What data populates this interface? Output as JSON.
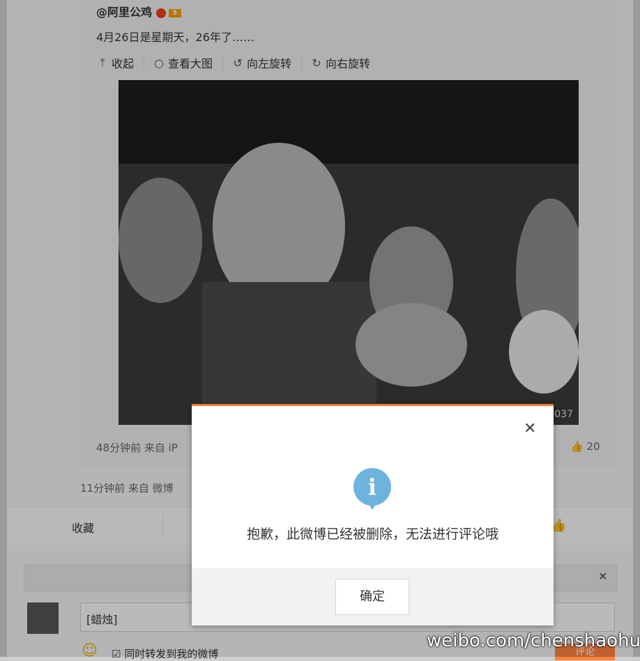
{
  "post": {
    "author": "@阿里公鸡",
    "badge_text": "5",
    "text": "4月26日是星期天，26年了……",
    "tools": [
      {
        "icon": "collapse-icon",
        "glyph": "⤒",
        "label": "收起"
      },
      {
        "icon": "search-icon",
        "glyph": "○",
        "label": "查看大图"
      },
      {
        "icon": "rotate-left-icon",
        "glyph": "↺",
        "label": "向左旋转"
      },
      {
        "icon": "rotate-right-icon",
        "glyph": "↻",
        "label": "向右旋转"
      }
    ],
    "image_watermark": "@阿里公鸡\n037",
    "meta": "48分钟前 来自 iP",
    "like_count": "20"
  },
  "outer_meta": "11分钟前 来自 微博",
  "actions": {
    "favorite": "收藏"
  },
  "comment": {
    "input_value": "[蜡烛]",
    "forward_label": "同时转发到我的微博",
    "submit_label": "评论"
  },
  "watermark": "weibo.com/chenshaohua",
  "dialog": {
    "message": "抱歉，此微博已经被删除，无法进行评论哦",
    "confirm_label": "确定",
    "close_glyph": "✕",
    "icon_glyph": "i"
  },
  "colors": {
    "accent": "#fa7d3c",
    "info_icon": "#6eb3dd"
  }
}
